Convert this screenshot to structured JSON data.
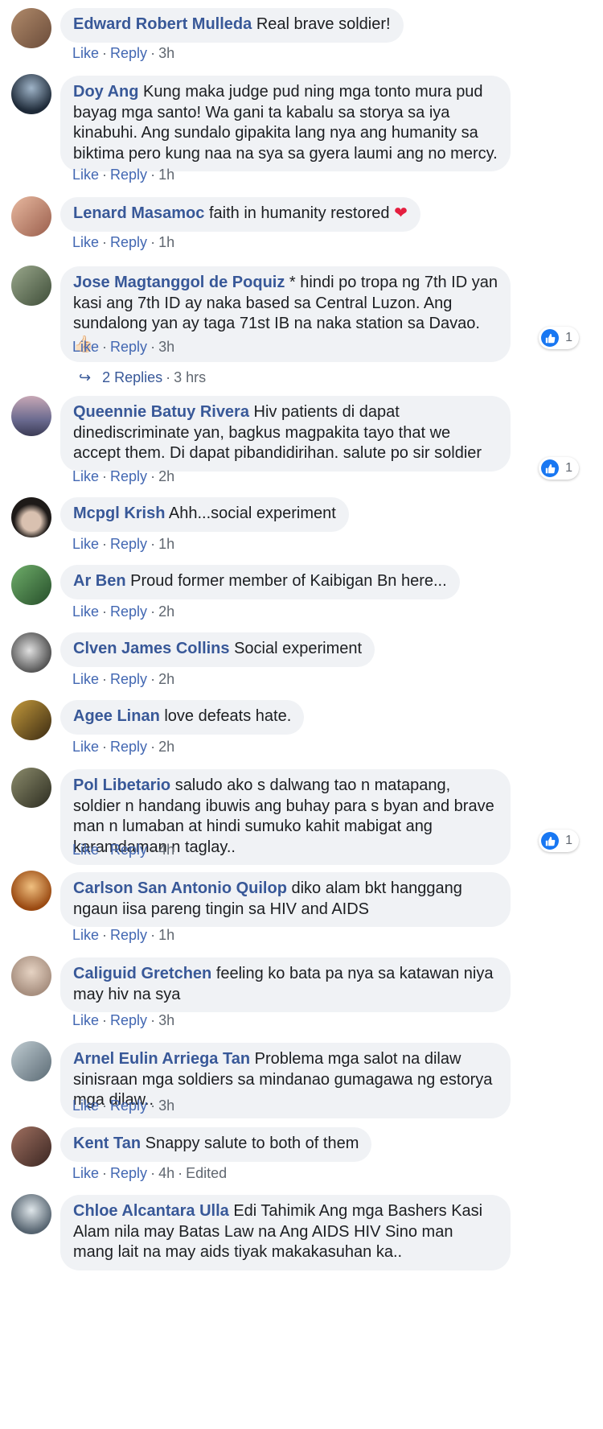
{
  "comments": [
    {
      "author": "Edward Robert Mulleda",
      "text": "Real brave soldier!",
      "time": "3h",
      "avatar_color": "#8b6a4e"
    },
    {
      "author": "Doy Ang",
      "text": "Kung maka judge pud ning mga tonto mura pud bayag mga santo! Wa gani ta kabalu sa storya sa iya kinabuhi. Ang sundalo gipakita lang nya ang humanity sa biktima pero kung naa na sya sa gyera laumi ang no mercy.",
      "time": "1h",
      "avatar_color": "#3b4a5c"
    },
    {
      "author": "Lenard Masamoc",
      "text": "faith in humanity restored",
      "emoji": "❤",
      "time": "1h",
      "avatar_color": "#c98d73"
    },
    {
      "author": "Jose Magtanggol de Poquiz",
      "text": "* hindi po tropa ng 7th ID yan kasi ang 7th ID ay naka based sa Central Luzon. Ang sundalong yan ay taga 71st IB na naka station sa Davao. 👍🏻",
      "time": "3h",
      "reaction_count": "1",
      "avatar_color": "#5b6e53"
    },
    {
      "author": "Queennie Batuy Rivera",
      "text": "Hiv patients di dapat dinediscriminate yan, bagkus magpakita tayo that we accept them. Di dapat pibandidirihan. salute po sir soldier",
      "time": "2h",
      "reaction_count": "1",
      "avatar_color": "#8a7a9a"
    },
    {
      "author": "Mcpgl Krish",
      "text": "Ahh...social experiment",
      "time": "1h",
      "avatar_color": "#2e2a28"
    },
    {
      "author": "Ar Ben",
      "text": "Proud former member of Kaibigan Bn here...",
      "time": "2h",
      "avatar_color": "#3d7a3f"
    },
    {
      "author": "Clven James Collins",
      "text": "Social experiment",
      "time": "2h",
      "avatar_color": "#6b6b6b"
    },
    {
      "author": "Agee Linan",
      "text": "love defeats hate.",
      "time": "2h",
      "avatar_color": "#7a5a1c"
    },
    {
      "author": "Pol Libetario",
      "text": "saludo ako s dalwang tao n matapang, soldier n handang ibuwis ang buhay para s byan and brave man n lumaban at hindi sumuko kahit mabigat ang karamdaman n taglay..",
      "time": "4h",
      "reaction_count": "1",
      "avatar_color": "#4d4e3a"
    },
    {
      "author": "Carlson San Antonio Quilop",
      "text": "diko alam bkt hanggang ngaun iisa pareng tingin sa HIV and AIDS",
      "time": "1h",
      "avatar_color": "#b86a2a"
    },
    {
      "author": "Caliguid Gretchen",
      "text": "feeling ko bata pa nya sa katawan niya may hiv na sya",
      "time": "3h",
      "avatar_color": "#d2b8a4"
    },
    {
      "author": "Arnel Eulin Arriega Tan",
      "text": "Problema mga salot na dilaw sinisraan mga soldiers sa mindanao gumagawa ng estorya mga dilaw..",
      "time": "3h",
      "avatar_color": "#8fa0a8"
    },
    {
      "author": "Kent Tan",
      "text": "Snappy salute to both of them",
      "time": "4h",
      "edited": "Edited",
      "avatar_color": "#6a4a42"
    },
    {
      "author": "Chloe Alcantara Ulla",
      "text": "Edi Tahimik Ang mga Bashers Kasi Alam nila may Batas Law na Ang AIDS HIV Sino man mang lait na may aids tiyak makakasuhan ka..",
      "avatar_color": "#7c8e9a"
    }
  ],
  "labels": {
    "like": "Like",
    "reply": "Reply",
    "sep": "·"
  },
  "replies_link": {
    "label": "2 Replies",
    "time": "3 hrs"
  },
  "colors": {
    "author": "#385898",
    "link": "#4267b2",
    "bubble": "#f0f2f5",
    "like_blue": "#1877f2"
  }
}
